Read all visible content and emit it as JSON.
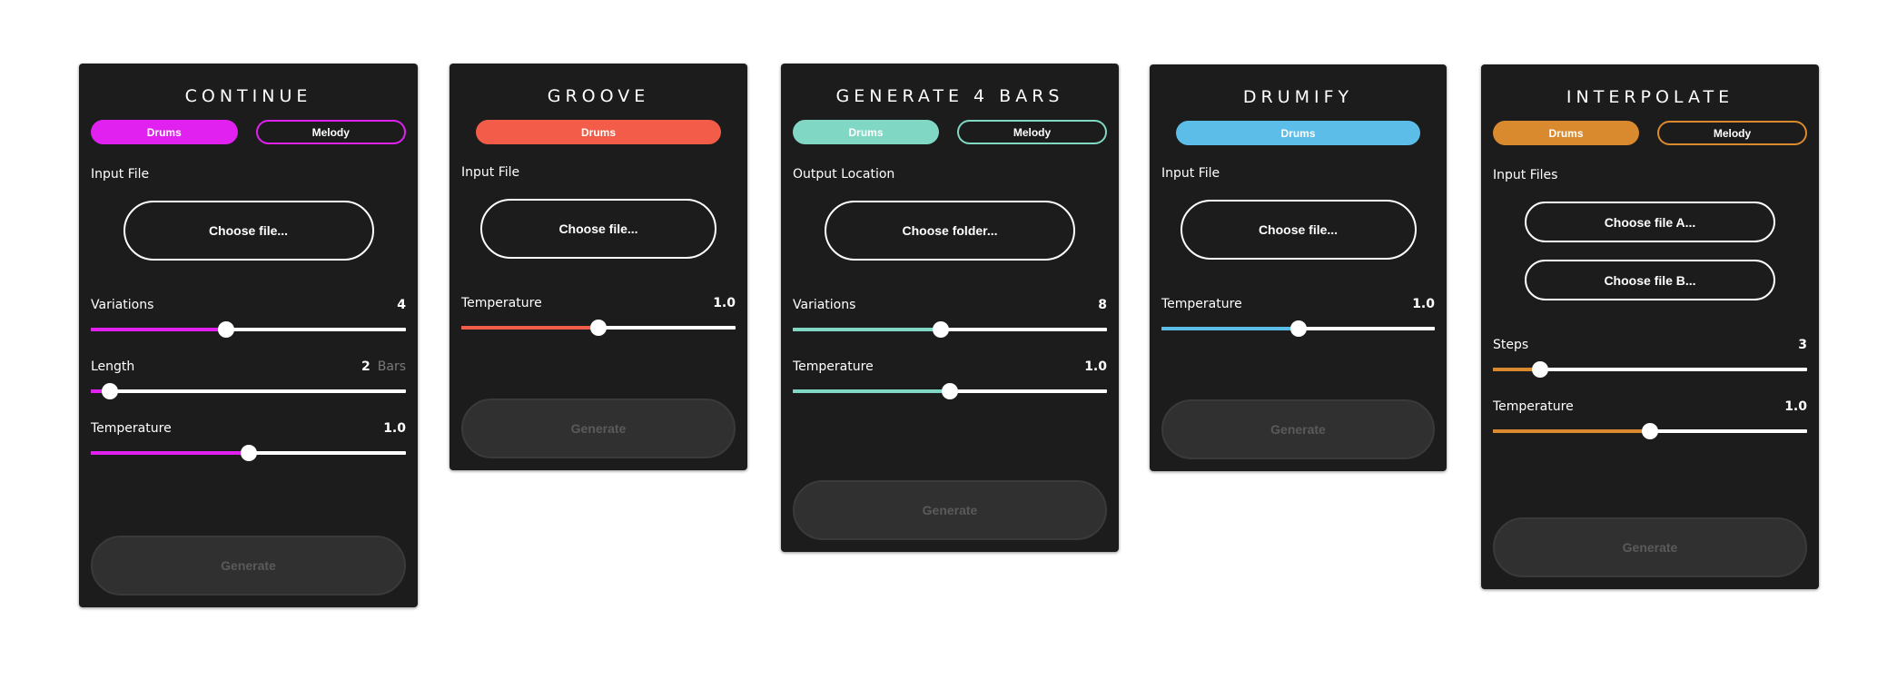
{
  "panels": [
    {
      "id": "continue",
      "title": "CONTINUE",
      "accent": "#e021f0",
      "toggles": [
        {
          "label": "Drums",
          "active": true
        },
        {
          "label": "Melody",
          "active": false
        }
      ],
      "input_label": "Input File",
      "choose_buttons": [
        "Choose file..."
      ],
      "sliders": [
        {
          "label": "Variations",
          "value": "4",
          "unit": "",
          "fraction": 0.43
        },
        {
          "label": "Length",
          "value": "2",
          "unit": "Bars",
          "fraction": 0.06
        },
        {
          "label": "Temperature",
          "value": "1.0",
          "unit": "",
          "fraction": 0.5
        }
      ],
      "generate_label": "Generate"
    },
    {
      "id": "groove",
      "title": "GROOVE",
      "accent": "#f25c48",
      "toggles": [
        {
          "label": "Drums",
          "active": true
        }
      ],
      "input_label": "Input File",
      "choose_buttons": [
        "Choose file..."
      ],
      "sliders": [
        {
          "label": "Temperature",
          "value": "1.0",
          "unit": "",
          "fraction": 0.5
        }
      ],
      "generate_label": "Generate"
    },
    {
      "id": "generate-4-bars",
      "title": "GENERATE 4 BARS",
      "accent": "#80d8c4",
      "toggles": [
        {
          "label": "Drums",
          "active": true
        },
        {
          "label": "Melody",
          "active": false
        }
      ],
      "input_label": "Output Location",
      "choose_buttons": [
        "Choose folder..."
      ],
      "sliders": [
        {
          "label": "Variations",
          "value": "8",
          "unit": "",
          "fraction": 0.47
        },
        {
          "label": "Temperature",
          "value": "1.0",
          "unit": "",
          "fraction": 0.5
        }
      ],
      "generate_label": "Generate"
    },
    {
      "id": "drumify",
      "title": "DRUMIFY",
      "accent": "#5bbde8",
      "toggles": [
        {
          "label": "Drums",
          "active": true
        }
      ],
      "input_label": "Input File",
      "choose_buttons": [
        "Choose file..."
      ],
      "sliders": [
        {
          "label": "Temperature",
          "value": "1.0",
          "unit": "",
          "fraction": 0.5
        }
      ],
      "generate_label": "Generate"
    },
    {
      "id": "interpolate",
      "title": "INTERPOLATE",
      "accent": "#d98a2e",
      "toggles": [
        {
          "label": "Drums",
          "active": true
        },
        {
          "label": "Melody",
          "active": false
        }
      ],
      "input_label": "Input Files",
      "choose_buttons": [
        "Choose file A...",
        "Choose file B..."
      ],
      "sliders": [
        {
          "label": "Steps",
          "value": "3",
          "unit": "",
          "fraction": 0.15
        },
        {
          "label": "Temperature",
          "value": "1.0",
          "unit": "",
          "fraction": 0.5
        }
      ],
      "generate_label": "Generate"
    }
  ]
}
